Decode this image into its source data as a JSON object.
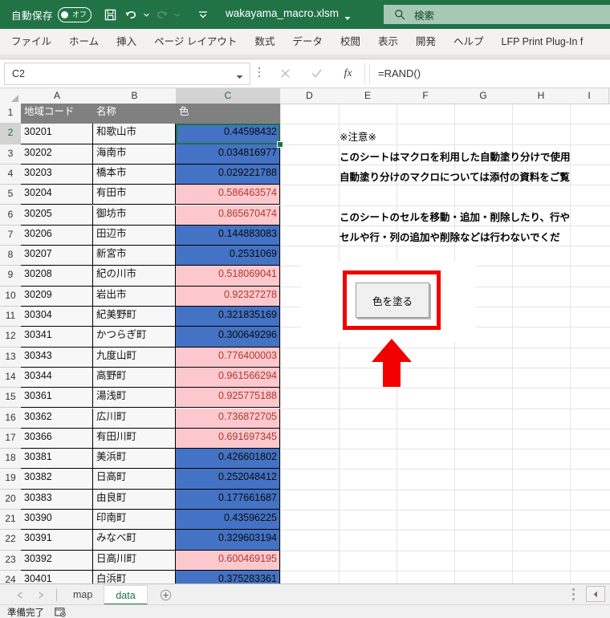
{
  "titlebar": {
    "autosave_label": "自動保存",
    "autosave_state": "オフ",
    "document_title": "wakayama_macro.xlsm",
    "save_icon": "save-icon",
    "undo_icon": "undo-icon",
    "redo_icon": "redo-icon",
    "qat_more_icon": "chevron-down-icon",
    "search_icon": "search-icon",
    "search_placeholder": "検索"
  },
  "ribbon": {
    "tabs": [
      {
        "label": "ファイル"
      },
      {
        "label": "ホーム"
      },
      {
        "label": "挿入"
      },
      {
        "label": "ページ レイアウト"
      },
      {
        "label": "数式"
      },
      {
        "label": "データ"
      },
      {
        "label": "校閲"
      },
      {
        "label": "表示"
      },
      {
        "label": "開発"
      },
      {
        "label": "ヘルプ"
      },
      {
        "label": "LFP Print Plug-In f"
      }
    ]
  },
  "formula_bar": {
    "name_box_value": "C2",
    "name_box_caret": "chevron-down-icon",
    "cancel_icon": "close-icon",
    "enter_icon": "check-icon",
    "function_icon": "fx-icon",
    "formula_value": "=RAND()"
  },
  "grid": {
    "columns": [
      "A",
      "B",
      "C",
      "D",
      "E",
      "F",
      "G",
      "H",
      "I"
    ],
    "selected_column": "C",
    "row_numbers": [
      "1",
      "2",
      "3",
      "4",
      "5",
      "6",
      "7",
      "8",
      "9",
      "10",
      "11",
      "12",
      "13",
      "14",
      "15",
      "16",
      "17",
      "18",
      "19",
      "20",
      "21",
      "22",
      "23",
      "24"
    ],
    "selected_row": "2",
    "headers": [
      "地域コード",
      "名称",
      "色"
    ],
    "rows": [
      {
        "code": "30201",
        "name": "和歌山市",
        "value": "0.44598432",
        "fill": "blue"
      },
      {
        "code": "30202",
        "name": "海南市",
        "value": "0.034816977",
        "fill": "blue"
      },
      {
        "code": "30203",
        "name": "橋本市",
        "value": "0.029221788",
        "fill": "blue"
      },
      {
        "code": "30204",
        "name": "有田市",
        "value": "0.586463574",
        "fill": "pink"
      },
      {
        "code": "30205",
        "name": "御坊市",
        "value": "0.865670474",
        "fill": "pink"
      },
      {
        "code": "30206",
        "name": "田辺市",
        "value": "0.144883083",
        "fill": "blue"
      },
      {
        "code": "30207",
        "name": "新宮市",
        "value": "0.2531069",
        "fill": "blue"
      },
      {
        "code": "30208",
        "name": "紀の川市",
        "value": "0.518069041",
        "fill": "pink"
      },
      {
        "code": "30209",
        "name": "岩出市",
        "value": "0.92327278",
        "fill": "pink"
      },
      {
        "code": "30304",
        "name": "紀美野町",
        "value": "0.321835169",
        "fill": "blue"
      },
      {
        "code": "30341",
        "name": "かつらぎ町",
        "value": "0.300649296",
        "fill": "blue"
      },
      {
        "code": "30343",
        "name": "九度山町",
        "value": "0.776400003",
        "fill": "pink"
      },
      {
        "code": "30344",
        "name": "高野町",
        "value": "0.961566294",
        "fill": "pink"
      },
      {
        "code": "30361",
        "name": "湯浅町",
        "value": "0.925775188",
        "fill": "pink"
      },
      {
        "code": "30362",
        "name": "広川町",
        "value": "0.736872705",
        "fill": "pink"
      },
      {
        "code": "30366",
        "name": "有田川町",
        "value": "0.691697345",
        "fill": "pink"
      },
      {
        "code": "30381",
        "name": "美浜町",
        "value": "0.426601802",
        "fill": "blue"
      },
      {
        "code": "30382",
        "name": "日高町",
        "value": "0.252048412",
        "fill": "blue"
      },
      {
        "code": "30383",
        "name": "由良町",
        "value": "0.177661687",
        "fill": "blue"
      },
      {
        "code": "30390",
        "name": "印南町",
        "value": "0.43596225",
        "fill": "blue"
      },
      {
        "code": "30391",
        "name": "みなべ町",
        "value": "0.329603194",
        "fill": "blue"
      },
      {
        "code": "30392",
        "name": "日高川町",
        "value": "0.600469195",
        "fill": "pink"
      },
      {
        "code": "30401",
        "name": "白浜町",
        "value": "0.375283361",
        "fill": "blue"
      }
    ]
  },
  "notes": {
    "title": "※注意※",
    "lines": [
      "このシートはマクロを利用した自動塗り分けで使用",
      "自動塗り分けのマクロについては添付の資料をご覧",
      "このシートのセルを移動・追加・削除したり、行や",
      "セルや行・列の追加や削除などは行わないでくだ"
    ]
  },
  "macro_button": {
    "label": "色を塗る",
    "highlight_color": "#f20000",
    "arrow_icon": "up-arrow-annotation"
  },
  "sheet_tabs": {
    "prev_icon": "triangle-left-icon",
    "next_icon": "triangle-right-icon",
    "tabs": [
      {
        "label": "map",
        "active": false
      },
      {
        "label": "data",
        "active": true
      }
    ],
    "add_icon": "plus-circle-icon",
    "hscroll_left_icon": "triangle-left-icon"
  },
  "statusbar": {
    "text": "準備完了",
    "macro_record_icon": "record-macro-icon"
  },
  "colors": {
    "brand_green": "#217346",
    "blue_fill": "#4472c4",
    "pink_fill": "#fcc8cd",
    "header_gray": "#808080"
  }
}
